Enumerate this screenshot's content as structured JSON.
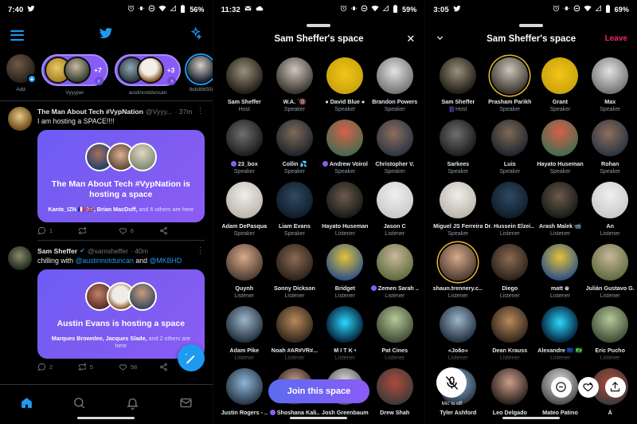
{
  "phone1": {
    "status": {
      "time": "7:40",
      "battery": "56%",
      "icons": [
        "twitter-bird",
        "alarm-icon",
        "vibrate-icon",
        "dnd-icon",
        "wifi-icon",
        "signal-icon",
        "battery-icon"
      ]
    },
    "topbar": {
      "menu": "hamburger-icon",
      "logo": "twitter-bird-icon",
      "sparkle": "sparkle-icon"
    },
    "fleets": [
      {
        "label": "Add",
        "type": "add"
      },
      {
        "label": "Vyyyper",
        "type": "space",
        "count": "+7"
      },
      {
        "label": "austinnotduncan",
        "type": "space",
        "count": "+3"
      },
      {
        "label": "tkdsl8655i",
        "type": "fleet"
      }
    ],
    "tweets": [
      {
        "name": "The Man About Tech #VypNation",
        "verified": false,
        "handle": "@Vyyy...",
        "time": "· 37m",
        "text": "I am hosting a SPACE!!!!",
        "card_title": "The Man About Tech #VypNation is hosting a space",
        "card_sub_bold": "Kantє_IZN 🇫🇷 🇬🇧, Brian MacDuff,",
        "card_sub_rest": " and 6 others are here",
        "replies": "1",
        "retweets": "",
        "likes": "6"
      },
      {
        "name": "Sam Sheffer",
        "verified": true,
        "handle": "@samsheffer",
        "time": "· 40m",
        "text_pre": "chilling with ",
        "mention1": "@austinnotduncan",
        "text_mid": " and ",
        "mention2": "@MKBHD",
        "card_title": "Austin Evans is hosting a space",
        "card_sub_bold": "Marques Brownlee, Jacques Slade,",
        "card_sub_rest": " and 2 others are here",
        "replies": "2",
        "retweets": "5",
        "likes": "58"
      }
    ],
    "fab": "compose-tweet-icon",
    "tabs": [
      "home-icon",
      "search-icon",
      "notifications-icon",
      "messages-icon"
    ]
  },
  "phone2": {
    "status": {
      "time": "11:32",
      "battery": "59%"
    },
    "title": "Sam Sheffer's space",
    "close": "✕",
    "join_label": "Join this space",
    "people": [
      {
        "name": "Sam Sheffer",
        "role": "Host",
        "img": "av-sam"
      },
      {
        "name": "W.A. ˋ🔞",
        "role": "Speaker",
        "img": "av-wa"
      },
      {
        "name": "● David Blue ●",
        "role": "Speaker",
        "img": "av-davidblue"
      },
      {
        "name": "Brandon Powers",
        "role": "Speaker",
        "img": "av-brandon"
      },
      {
        "name": "23_box",
        "role": "Speaker",
        "img": "av-23box",
        "badge": true
      },
      {
        "name": "Collin 💦",
        "role": "Speaker",
        "img": "av-collin"
      },
      {
        "name": "Andrew Voirol",
        "role": "Speaker",
        "img": "av-andrew",
        "badge": true
      },
      {
        "name": "Christopher V.",
        "role": "Speaker",
        "img": "av-chris"
      },
      {
        "name": "Adam DePasqua",
        "role": "Speaker",
        "img": "av-adam"
      },
      {
        "name": "Liam Evans",
        "role": "Speaker",
        "img": "av-liam"
      },
      {
        "name": "Hayato Huseman",
        "role": "Listener",
        "img": "av-hayato"
      },
      {
        "name": "Jason C",
        "role": "Listener",
        "img": "av-jason"
      },
      {
        "name": "Quynh",
        "role": "Listener",
        "img": "av-quynh"
      },
      {
        "name": "Sonny Dickson",
        "role": "Listener",
        "img": "av-sonny"
      },
      {
        "name": "Bridget",
        "role": "Listener",
        "img": "av-bridget"
      },
      {
        "name": "Zemen Sarah ..",
        "role": "Listener",
        "img": "av-zemen",
        "badge": true
      },
      {
        "name": "Adam Pike",
        "role": "Listener",
        "img": "av-adampike"
      },
      {
        "name": "Noah #AR#VR#...",
        "role": "Listener",
        "img": "av-noah"
      },
      {
        "name": "M I T K •",
        "role": "Listener",
        "img": "av-mitk"
      },
      {
        "name": "Pat Cines",
        "role": "Listener",
        "img": "av-pat"
      },
      {
        "name": "Justin Rogers - ..",
        "role": "",
        "img": "av-justin"
      },
      {
        "name": "Shoshana Kali..",
        "role": "",
        "img": "av-shoshana",
        "badge": true
      },
      {
        "name": "Josh Greenbaum",
        "role": "",
        "img": "av-josh"
      },
      {
        "name": "Drew Shah",
        "role": "",
        "img": "av-drew"
      }
    ]
  },
  "phone3": {
    "status": {
      "time": "3:05",
      "battery": "69%"
    },
    "title": "Sam Sheffer's space",
    "chevron": "chevron-down-icon",
    "leave_label": "Leave",
    "mic_label": "Mic is off",
    "controls": [
      "mic-off-button",
      "request-button",
      "react-heart-button",
      "share-button"
    ],
    "people": [
      {
        "name": "Sam Sheffer",
        "role": "Host",
        "img": "av-sam",
        "speaking": true
      },
      {
        "name": "Prasham Parikh",
        "role": "Speaker",
        "img": "av-prasham",
        "ring": true
      },
      {
        "name": "Grant",
        "role": "Speaker",
        "img": "av-grant"
      },
      {
        "name": "Max",
        "role": "Speaker",
        "img": "av-max"
      },
      {
        "name": "Sarkees",
        "role": "Speaker",
        "img": "av-sarkees"
      },
      {
        "name": "Luis",
        "role": "Speaker",
        "img": "av-luis"
      },
      {
        "name": "Hayato Huseman",
        "role": "Speaker",
        "img": "av-hayato3"
      },
      {
        "name": "Rohan",
        "role": "Speaker",
        "img": "av-rohan"
      },
      {
        "name": "Miguel JS Ferreira",
        "role": "Speaker",
        "img": "av-miguel"
      },
      {
        "name": "Dr. Hussein Elzei...",
        "role": "Listener",
        "img": "av-hussein"
      },
      {
        "name": "Arash Malek 📹",
        "role": "Listener",
        "img": "av-arash"
      },
      {
        "name": "An",
        "role": "Listener",
        "img": "av-an"
      },
      {
        "name": "shaun.trennery.c...",
        "role": "Listener",
        "img": "av-shaun",
        "ring": true
      },
      {
        "name": "Diego",
        "role": "Listener",
        "img": "av-diego"
      },
      {
        "name": "matt ⊛",
        "role": "Listener",
        "img": "av-matt"
      },
      {
        "name": "Julián Gustavo G.",
        "role": "Listener",
        "img": "av-julian"
      },
      {
        "name": "«João»",
        "role": "Listener",
        "img": "av-joao"
      },
      {
        "name": "Dean Krauss",
        "role": "Listener",
        "img": "av-dean"
      },
      {
        "name": "Alexandre 🇪🇺 🇧🇷",
        "role": "Listener",
        "img": "av-alexandre"
      },
      {
        "name": "Eric Pucho",
        "role": "Listener",
        "img": "av-eric"
      },
      {
        "name": "Tyler Ashford",
        "role": "",
        "img": "av-tyler"
      },
      {
        "name": "Leo Delgado",
        "role": "",
        "img": "av-leo"
      },
      {
        "name": "Mateo Patino",
        "role": "",
        "img": "av-mateo"
      },
      {
        "name": "Á",
        "role": "",
        "img": "av-last"
      }
    ]
  },
  "colors": {
    "twitter_blue": "#1d9bf0",
    "space_purple": "#8b5cf6",
    "leave_red": "#f4245e",
    "background": "#000000",
    "text_secondary": "#71767b"
  }
}
